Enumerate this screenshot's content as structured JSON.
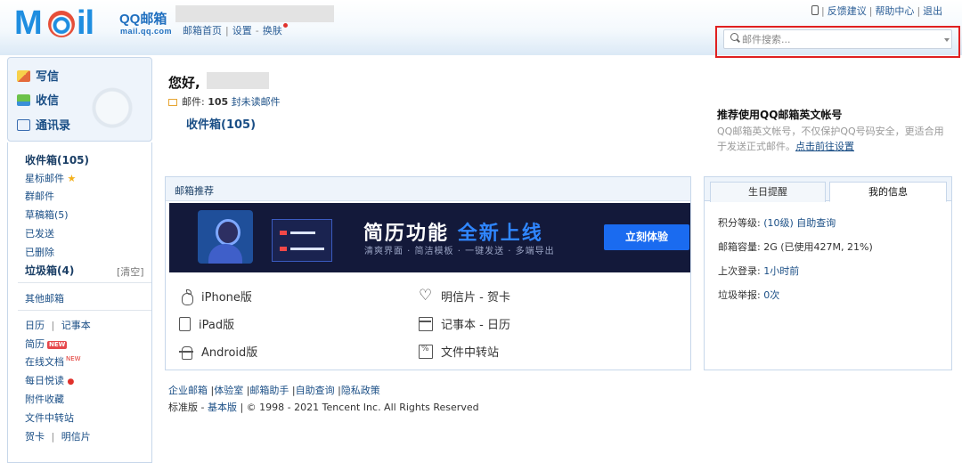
{
  "header": {
    "logo_brand": "QQ邮箱",
    "logo_domain": "mail.qq.com",
    "links": {
      "home": "邮箱首页",
      "settings": "设置",
      "skin": "换肤"
    },
    "right_links": {
      "feedback": "反馈建议",
      "help": "帮助中心",
      "logout": "退出"
    },
    "search_placeholder": "邮件搜索..."
  },
  "sidebar": {
    "actions": {
      "compose": "写信",
      "receive": "收信",
      "contacts": "通讯录"
    },
    "folders": {
      "inbox": "收件箱(105)",
      "starred": "星标邮件",
      "group": "群邮件",
      "drafts": "草稿箱(5)",
      "sent": "已发送",
      "deleted": "已删除",
      "spam": "垃圾箱(4)",
      "clear": "[清空]",
      "other": "其他邮箱"
    },
    "tools": {
      "calendar": "日历",
      "notes": "记事本",
      "resume": "简历",
      "new_tag": "NEW",
      "online_docs": "在线文档",
      "daily": "每日悦读",
      "attachments": "附件收藏",
      "transfer": "文件中转站",
      "cards": "贺卡",
      "postcards": "明信片"
    }
  },
  "main": {
    "greeting": "您好,",
    "mail_label": "邮件:",
    "unread_count": "105",
    "unread_text": "封未读邮件",
    "inbox_link": "收件箱(105)"
  },
  "recommend_card": {
    "title": "推荐使用QQ邮箱英文帐号",
    "desc": "QQ邮箱英文帐号，不仅保护QQ号码安全，更适合用于发送正式邮件。",
    "link": "点击前往设置"
  },
  "rec_panel": {
    "title": "邮箱推荐",
    "banner_title_a": "简历功能",
    "banner_title_b": "全新上线",
    "banner_sub": "清爽界面 · 简洁模板 · 一键发送 · 多端导出",
    "banner_button": "立刻体验",
    "apps": {
      "iphone": "iPhone版",
      "ipad": "iPad版",
      "android": "Android版",
      "postcard": "明信片 - 贺卡",
      "notes": "记事本 - 日历",
      "transfer": "文件中转站"
    }
  },
  "footer": {
    "line1": [
      "企业邮箱",
      "体验室",
      "邮箱助手",
      "自助查询",
      "隐私政策"
    ],
    "std": "标准版",
    "basic": "基本版",
    "copyright": "| © 1998 - 2021 Tencent Inc. All Rights Reserved"
  },
  "info_panel": {
    "tab_birthday": "生日提醒",
    "tab_myinfo": "我的信息",
    "level_label": "积分等级:",
    "level_value": "(10级) 自助查询",
    "capacity_label": "邮箱容量:",
    "capacity_value": "2G (已使用427M, 21%)",
    "last_login_label": "上次登录:",
    "last_login_value": "1小时前",
    "spam_report_label": "垃圾举报:",
    "spam_report_value": "0次"
  },
  "colors": {
    "brand_blue": "#1f8ee0",
    "link_blue": "#1b4f86",
    "highlight_red": "#e02020",
    "banner_bg": "#13193a",
    "banner_button": "#1a6bf0"
  }
}
